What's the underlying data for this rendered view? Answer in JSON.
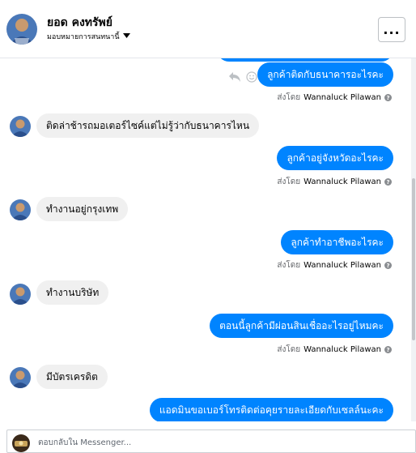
{
  "header": {
    "contact_name": "ยอด คงทรัพย์",
    "assignee_label": "มอบหมายการสนทนานี้",
    "more_label": "..."
  },
  "messages": [
    {
      "direction": "out",
      "text": "ลูกค้าติดกับธนาคารอะไรคะ",
      "sent_by_label": "ส่งโดย",
      "sent_by_name": "Wannaluck Pilawan"
    },
    {
      "direction": "in",
      "text": "ติดล่าช้ารถมอเตอร์ไซค์แต่ไม่รู้ว่ากับธนาคารไหน"
    },
    {
      "direction": "out",
      "text": "ลูกค้าอยู่จังหวัดอะไรคะ",
      "sent_by_label": "ส่งโดย",
      "sent_by_name": "Wannaluck Pilawan"
    },
    {
      "direction": "in",
      "text": "ทำงานอยู่กรุงเทพ"
    },
    {
      "direction": "out",
      "text": "ลูกค้าทำอาชีพอะไรคะ",
      "sent_by_label": "ส่งโดย",
      "sent_by_name": "Wannaluck Pilawan"
    },
    {
      "direction": "in",
      "text": "ทำงานบริษัท"
    },
    {
      "direction": "out",
      "text": "ตอนนี้ลูกค้ามีผ่อนสินเชื่ออะไรอยู่ไหมคะ",
      "sent_by_label": "ส่งโดย",
      "sent_by_name": "Wannaluck Pilawan"
    },
    {
      "direction": "in",
      "text": "มีบัตรเครดิต"
    },
    {
      "direction": "out",
      "text": "แอดมินขอเบอร์โทรติดต่อคุยรายละเอียดกับเซลล์นะคะ"
    }
  ],
  "composer": {
    "placeholder": "ตอบกลับใน Messenger..."
  },
  "icons": {
    "reply": "reply-icon",
    "react": "smiley-icon",
    "help": "help-circle-icon",
    "more": "more-horizontal-icon",
    "caret": "caret-down-icon"
  },
  "colors": {
    "outgoing_bubble": "#0084ff",
    "incoming_bubble": "#f0f0f0",
    "meta_text": "#65676b"
  }
}
